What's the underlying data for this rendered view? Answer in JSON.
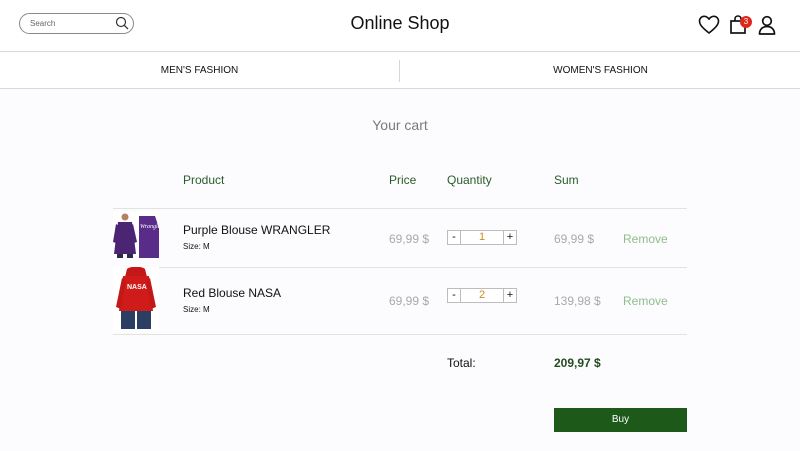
{
  "header": {
    "search_placeholder": "Search",
    "brand": "Online Shop",
    "cart_count": "3"
  },
  "nav": {
    "tabs": [
      {
        "label": "MEN'S FASHION"
      },
      {
        "label": "WOMEN'S FASHION"
      }
    ]
  },
  "cart": {
    "title": "Your cart",
    "columns": {
      "product": "Product",
      "price": "Price",
      "quantity": "Quantity",
      "sum": "Sum"
    },
    "items": [
      {
        "name": "Purple Blouse WRANGLER",
        "size": "Size: M",
        "price": "69,99 $",
        "qty_minus": "-",
        "qty": "1",
        "qty_plus": "+",
        "sum": "69,99 $",
        "remove": "Remove",
        "image_icon": "purple-sweatshirt-photo"
      },
      {
        "name": "Red Blouse NASA",
        "size": "Size: M",
        "price": "69,99 $",
        "qty_minus": "-",
        "qty": "2",
        "qty_plus": "+",
        "sum": "139,98 $",
        "remove": "Remove",
        "image_icon": "red-hoodie-photo"
      }
    ],
    "total_label": "Total:",
    "total_value": "209,97 $",
    "buy_label": "Buy"
  },
  "colors": {
    "accent": "#1d5a1a",
    "remove": "#8fbe8a",
    "quantity": "#d08a1e",
    "badge": "#e0261b"
  }
}
